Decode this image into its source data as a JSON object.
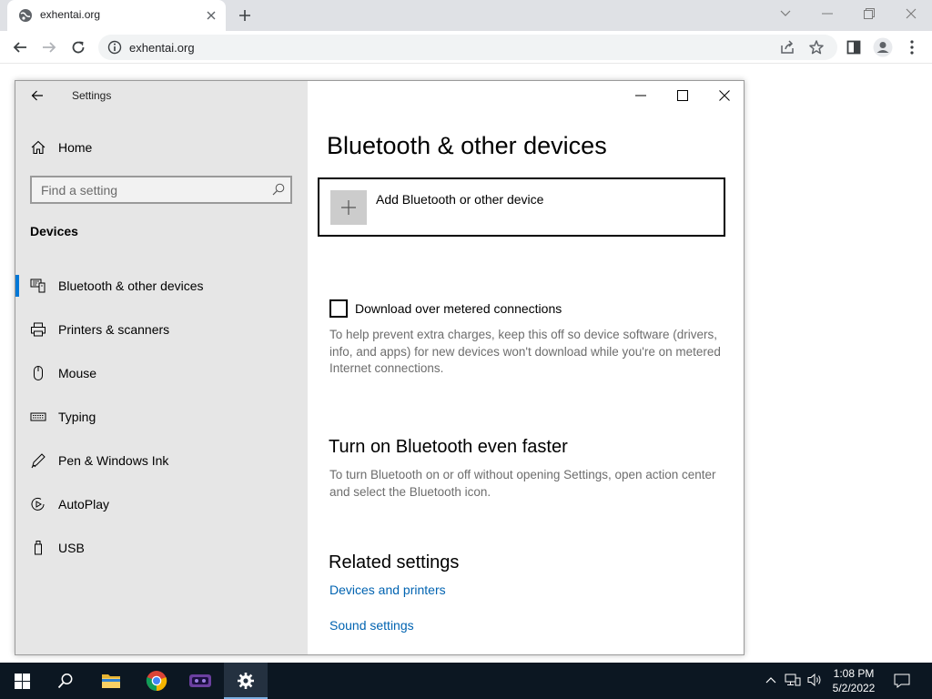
{
  "browser": {
    "tab_title": "exhentai.org",
    "url": "exhentai.org",
    "icons": [
      "globe-icon",
      "tab-close-icon",
      "new-tab-icon",
      "tab-search-icon",
      "minimize-icon",
      "restore-icon",
      "close-icon",
      "back-icon",
      "forward-icon",
      "reload-icon",
      "info-icon",
      "share-icon",
      "star-icon",
      "side-panel-icon",
      "profile-icon",
      "menu-icon"
    ]
  },
  "settings": {
    "app_title": "Settings",
    "home_label": "Home",
    "search_placeholder": "Find a setting",
    "section": "Devices",
    "nav": [
      {
        "label": "Bluetooth & other devices",
        "icon": "bluetooth-devices-icon",
        "selected": true
      },
      {
        "label": "Printers & scanners",
        "icon": "printer-icon",
        "selected": false
      },
      {
        "label": "Mouse",
        "icon": "mouse-icon",
        "selected": false
      },
      {
        "label": "Typing",
        "icon": "keyboard-icon",
        "selected": false
      },
      {
        "label": "Pen & Windows Ink",
        "icon": "pen-icon",
        "selected": false
      },
      {
        "label": "AutoPlay",
        "icon": "autoplay-icon",
        "selected": false
      },
      {
        "label": "USB",
        "icon": "usb-icon",
        "selected": false
      }
    ],
    "accent": "#0078d7"
  },
  "main": {
    "title": "Bluetooth & other devices",
    "add_device": "Add Bluetooth or other device",
    "metered_label": "Download over metered connections",
    "metered_checked": false,
    "metered_desc": "To help prevent extra charges, keep this off so device software (drivers, info, and apps) for new devices won't download while you're on metered Internet connections.",
    "faster_heading": "Turn on Bluetooth even faster",
    "faster_desc": "To turn Bluetooth on or off without opening Settings, open action center and select the Bluetooth icon.",
    "related_heading": "Related settings",
    "link_devices_printers": "Devices and printers",
    "link_sound": "Sound settings",
    "link_color": "#0063b1"
  },
  "taskbar": {
    "apps": [
      "windows-start-icon",
      "search-icon",
      "file-explorer-icon",
      "chrome-icon",
      "app-icon",
      "settings-gear-icon"
    ],
    "time": "1:08 PM",
    "date": "5/2/2022",
    "tray": [
      "chevron-up-icon",
      "network-icon",
      "volume-icon"
    ],
    "notification": "notification-icon"
  }
}
